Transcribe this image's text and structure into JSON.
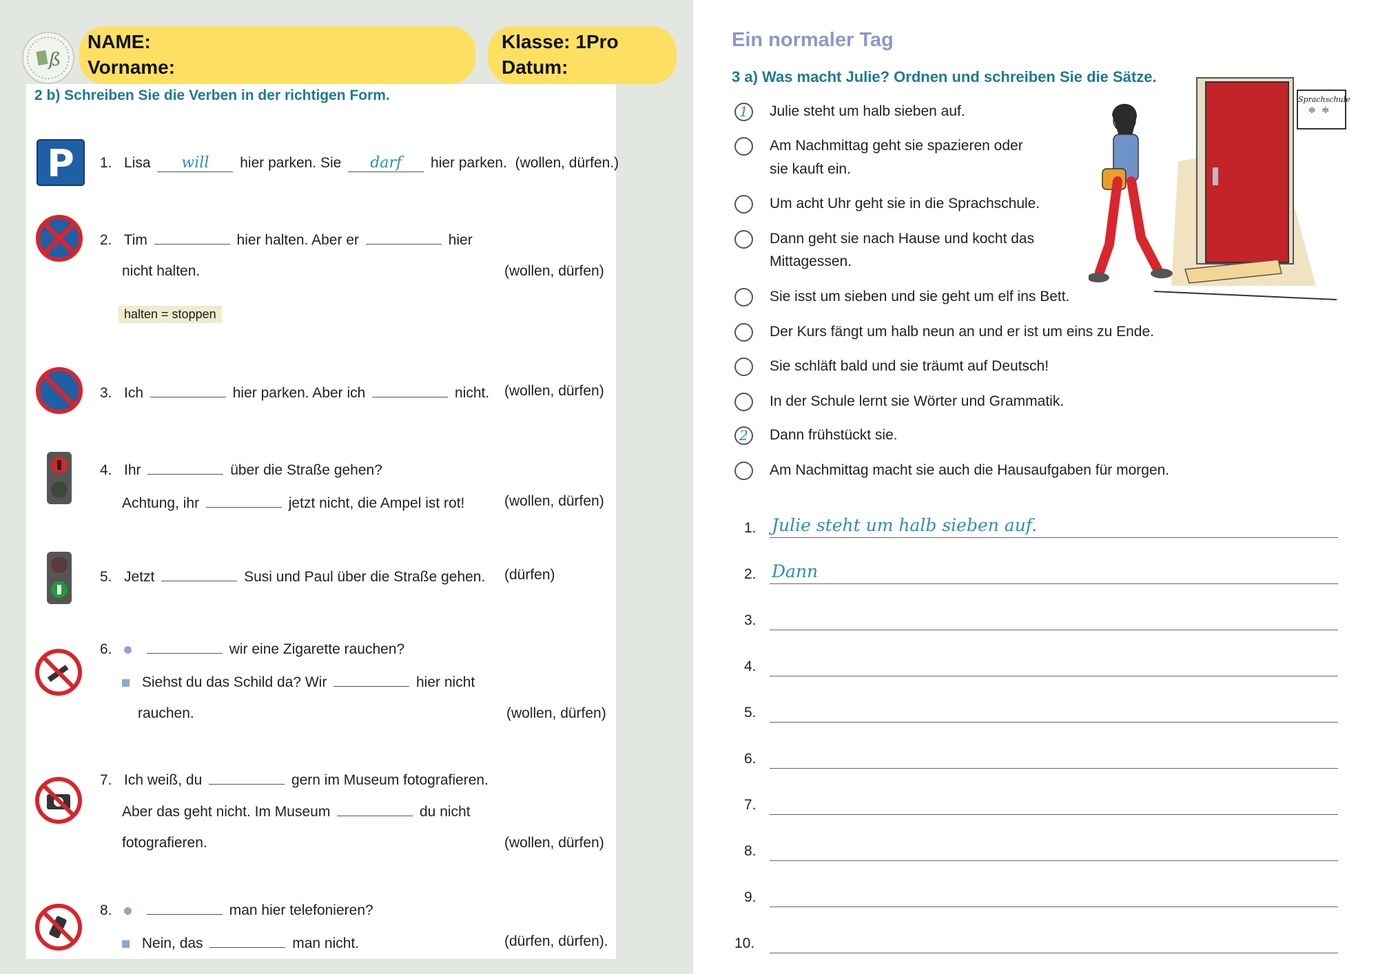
{
  "header": {
    "name_label": "NAME:",
    "vorname_label": "Vorname:",
    "klasse_label": "Klasse: 1Pro",
    "datum_label": "Datum:"
  },
  "left": {
    "title": "2 b)  Schreiben Sie die Verben in der richtigen Form.",
    "items": [
      {
        "num": "1.",
        "icon": "parking-sign-icon",
        "parts": [
          "Lisa",
          "hier parken. Sie",
          "hier parken.",
          "(wollen, dürfen.)"
        ],
        "answers": [
          "will",
          "darf"
        ]
      },
      {
        "num": "2.",
        "icon": "no-stopping-sign-icon",
        "parts": [
          "Tim",
          "hier halten.   Aber er",
          "hier",
          "nicht halten.",
          "(wollen, dürfen)"
        ],
        "note": "halten = stoppen"
      },
      {
        "num": "3.",
        "icon": "no-parking-sign-icon",
        "parts": [
          "Ich",
          "hier parken. Aber ich",
          "nicht.",
          "(wollen, dürfen)"
        ]
      },
      {
        "num": "4.",
        "icon": "red-traffic-light-icon",
        "parts": [
          "Ihr",
          "über die Straße gehen?",
          "Achtung, ihr",
          "jetzt nicht, die Ampel ist rot!",
          "(wollen, dürfen)"
        ]
      },
      {
        "num": "5.",
        "icon": "green-traffic-light-icon",
        "parts": [
          "Jetzt",
          "Susi und Paul über die Straße gehen.",
          "(dürfen)"
        ]
      },
      {
        "num": "6.",
        "icon": "no-smoking-sign-icon",
        "parts": [
          "wir eine Zigarette rauchen?",
          "Siehst du das Schild da? Wir",
          "hier nicht",
          "rauchen.",
          "(wollen, dürfen)"
        ]
      },
      {
        "num": "7.",
        "icon": "no-photography-sign-icon",
        "parts": [
          "Ich weiß, du",
          "gern im Museum fotografieren.",
          "Aber das geht nicht. Im Museum",
          "du nicht",
          "fotografieren.",
          "(wollen, dürfen)"
        ]
      },
      {
        "num": "8.",
        "icon": "no-phone-sign-icon",
        "parts": [
          "man hier telefonieren?",
          "Nein, das",
          "man nicht.",
          "(dürfen, dürfen)."
        ]
      }
    ]
  },
  "right": {
    "title": "Ein normaler Tag",
    "subtitle": "3 a)  Was macht Julie? Ordnen und schreiben Sie die Sätze.",
    "sentences": [
      {
        "order": "1",
        "text": "Julie steht um halb sieben auf."
      },
      {
        "order": "",
        "text": "Am Nachmittag geht sie spazieren oder",
        "text2": "sie kauft ein."
      },
      {
        "order": "",
        "text": "Um acht Uhr geht sie in die Sprachschule."
      },
      {
        "order": "",
        "text": "Dann geht sie nach Hause und kocht das",
        "text2": "Mittagessen."
      },
      {
        "order": "",
        "text": "Sie isst um sieben und sie geht um elf ins Bett."
      },
      {
        "order": "",
        "text": "Der Kurs fängt um halb neun an und er ist um eins zu Ende."
      },
      {
        "order": "",
        "text": "Sie schläft bald und sie träumt auf Deutsch!"
      },
      {
        "order": "",
        "text": "In der Schule lernt sie Wörter und Grammatik."
      },
      {
        "order": "2",
        "text": "Dann frühstückt sie."
      },
      {
        "order": "",
        "text": "Am Nachmittag macht sie auch die Hausaufgaben für morgen."
      }
    ],
    "sign_text": "Sprachschule",
    "answer_lines": [
      {
        "num": "1.",
        "text": "Julie steht um halb sieben auf."
      },
      {
        "num": "2.",
        "text": "Dann"
      },
      {
        "num": "3.",
        "text": ""
      },
      {
        "num": "4.",
        "text": ""
      },
      {
        "num": "5.",
        "text": ""
      },
      {
        "num": "6.",
        "text": ""
      },
      {
        "num": "7.",
        "text": ""
      },
      {
        "num": "8.",
        "text": ""
      },
      {
        "num": "9.",
        "text": ""
      },
      {
        "num": "10.",
        "text": ""
      }
    ]
  }
}
